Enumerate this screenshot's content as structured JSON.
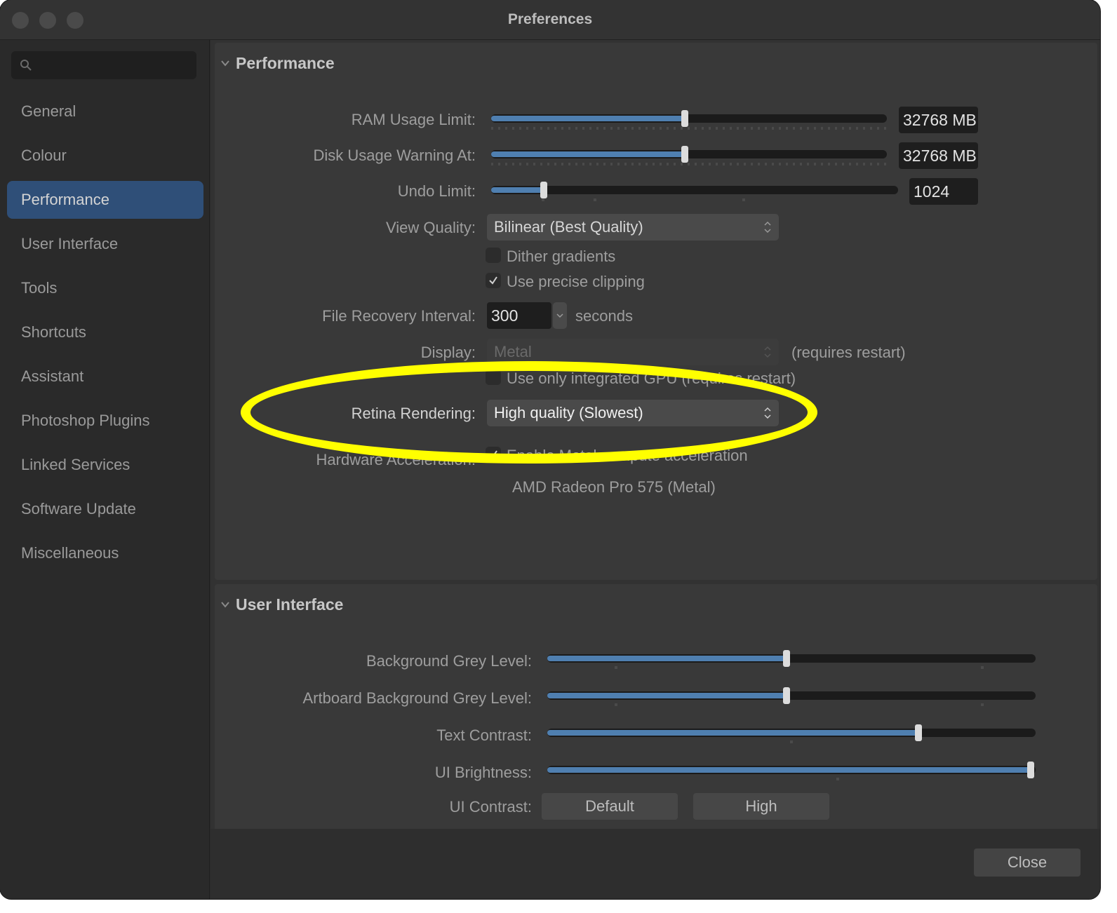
{
  "window": {
    "title": "Preferences"
  },
  "search": {
    "placeholder": ""
  },
  "sidebar": {
    "items": [
      {
        "label": "General"
      },
      {
        "label": "Colour"
      },
      {
        "label": "Performance"
      },
      {
        "label": "User Interface"
      },
      {
        "label": "Tools"
      },
      {
        "label": "Shortcuts"
      },
      {
        "label": "Assistant"
      },
      {
        "label": "Photoshop Plugins"
      },
      {
        "label": "Linked Services"
      },
      {
        "label": "Software Update"
      },
      {
        "label": "Miscellaneous"
      }
    ],
    "selected": "Performance"
  },
  "performance": {
    "header": "Performance",
    "ram_label": "RAM Usage Limit:",
    "ram_value": "32768 MB",
    "ram_level": 0.49,
    "disk_label": "Disk Usage Warning At:",
    "disk_value": "32768 MB",
    "disk_level": 0.49,
    "undo_label": "Undo Limit:",
    "undo_value": "1024",
    "undo_level": 0.13,
    "view_quality_label": "View Quality:",
    "view_quality_value": "Bilinear (Best Quality)",
    "dither_label": "Dither gradients",
    "dither_checked": false,
    "precise_clipping_label": "Use precise clipping",
    "precise_clipping_checked": true,
    "file_recovery_label": "File Recovery Interval:",
    "file_recovery_value": "300",
    "file_recovery_unit": "seconds",
    "display_label": "Display:",
    "display_value": "Metal",
    "display_note": "(requires restart)",
    "integrated_gpu_label": "Use only integrated GPU (requires restart)",
    "integrated_gpu_checked": false,
    "retina_label": "Retina Rendering:",
    "retina_value": "High quality (Slowest)",
    "hw_accel_label": "Hardware Acceleration:",
    "metal_compute_label": "Enable Metal compute acceleration",
    "metal_compute_checked": true,
    "gpu_name": "AMD Radeon Pro 575 (Metal)"
  },
  "user_interface": {
    "header": "User Interface",
    "bg_grey_label": "Background Grey Level:",
    "bg_grey_level": 0.49,
    "artboard_grey_label": "Artboard Background Grey Level:",
    "artboard_grey_level": 0.49,
    "text_contrast_label": "Text Contrast:",
    "text_contrast_level": 0.76,
    "ui_brightness_label": "UI Brightness:",
    "ui_brightness_level": 0.99,
    "ui_contrast_label": "UI Contrast:",
    "contrast_default": "Default",
    "contrast_high": "High"
  },
  "footer": {
    "close_label": "Close"
  },
  "colors": {
    "accent": "#2f4f78",
    "slider_fill": "#4f7fb0",
    "highlight": "#ffff00"
  }
}
